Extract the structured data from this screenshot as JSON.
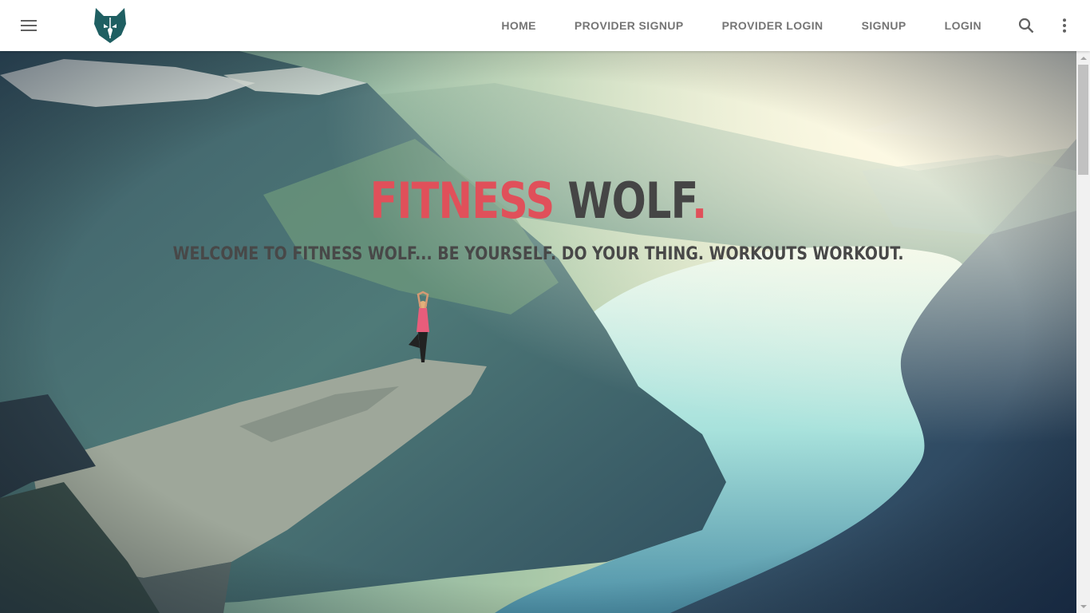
{
  "header": {
    "menu_icon": "hamburger-menu-icon",
    "logo_icon": "wolf-logo-icon",
    "nav": [
      {
        "label": "HOME"
      },
      {
        "label": "PROVIDER SIGNUP"
      },
      {
        "label": "PROVIDER LOGIN"
      },
      {
        "label": "SIGNUP"
      },
      {
        "label": "LOGIN"
      }
    ],
    "search_icon": "search-icon",
    "more_icon": "more-vert-icon"
  },
  "hero": {
    "title_part1": "FITNESS",
    "title_part2": "WOLF",
    "title_part3": ".",
    "subtitle": "WELCOME TO FITNESS WOLF... BE YOURSELF. DO YOUR THING. WORKOUTS WORKOUT."
  },
  "colors": {
    "accent": "#e0505a",
    "dark_text": "#454545",
    "nav_text": "#757575",
    "logo": "#1f5f62"
  }
}
